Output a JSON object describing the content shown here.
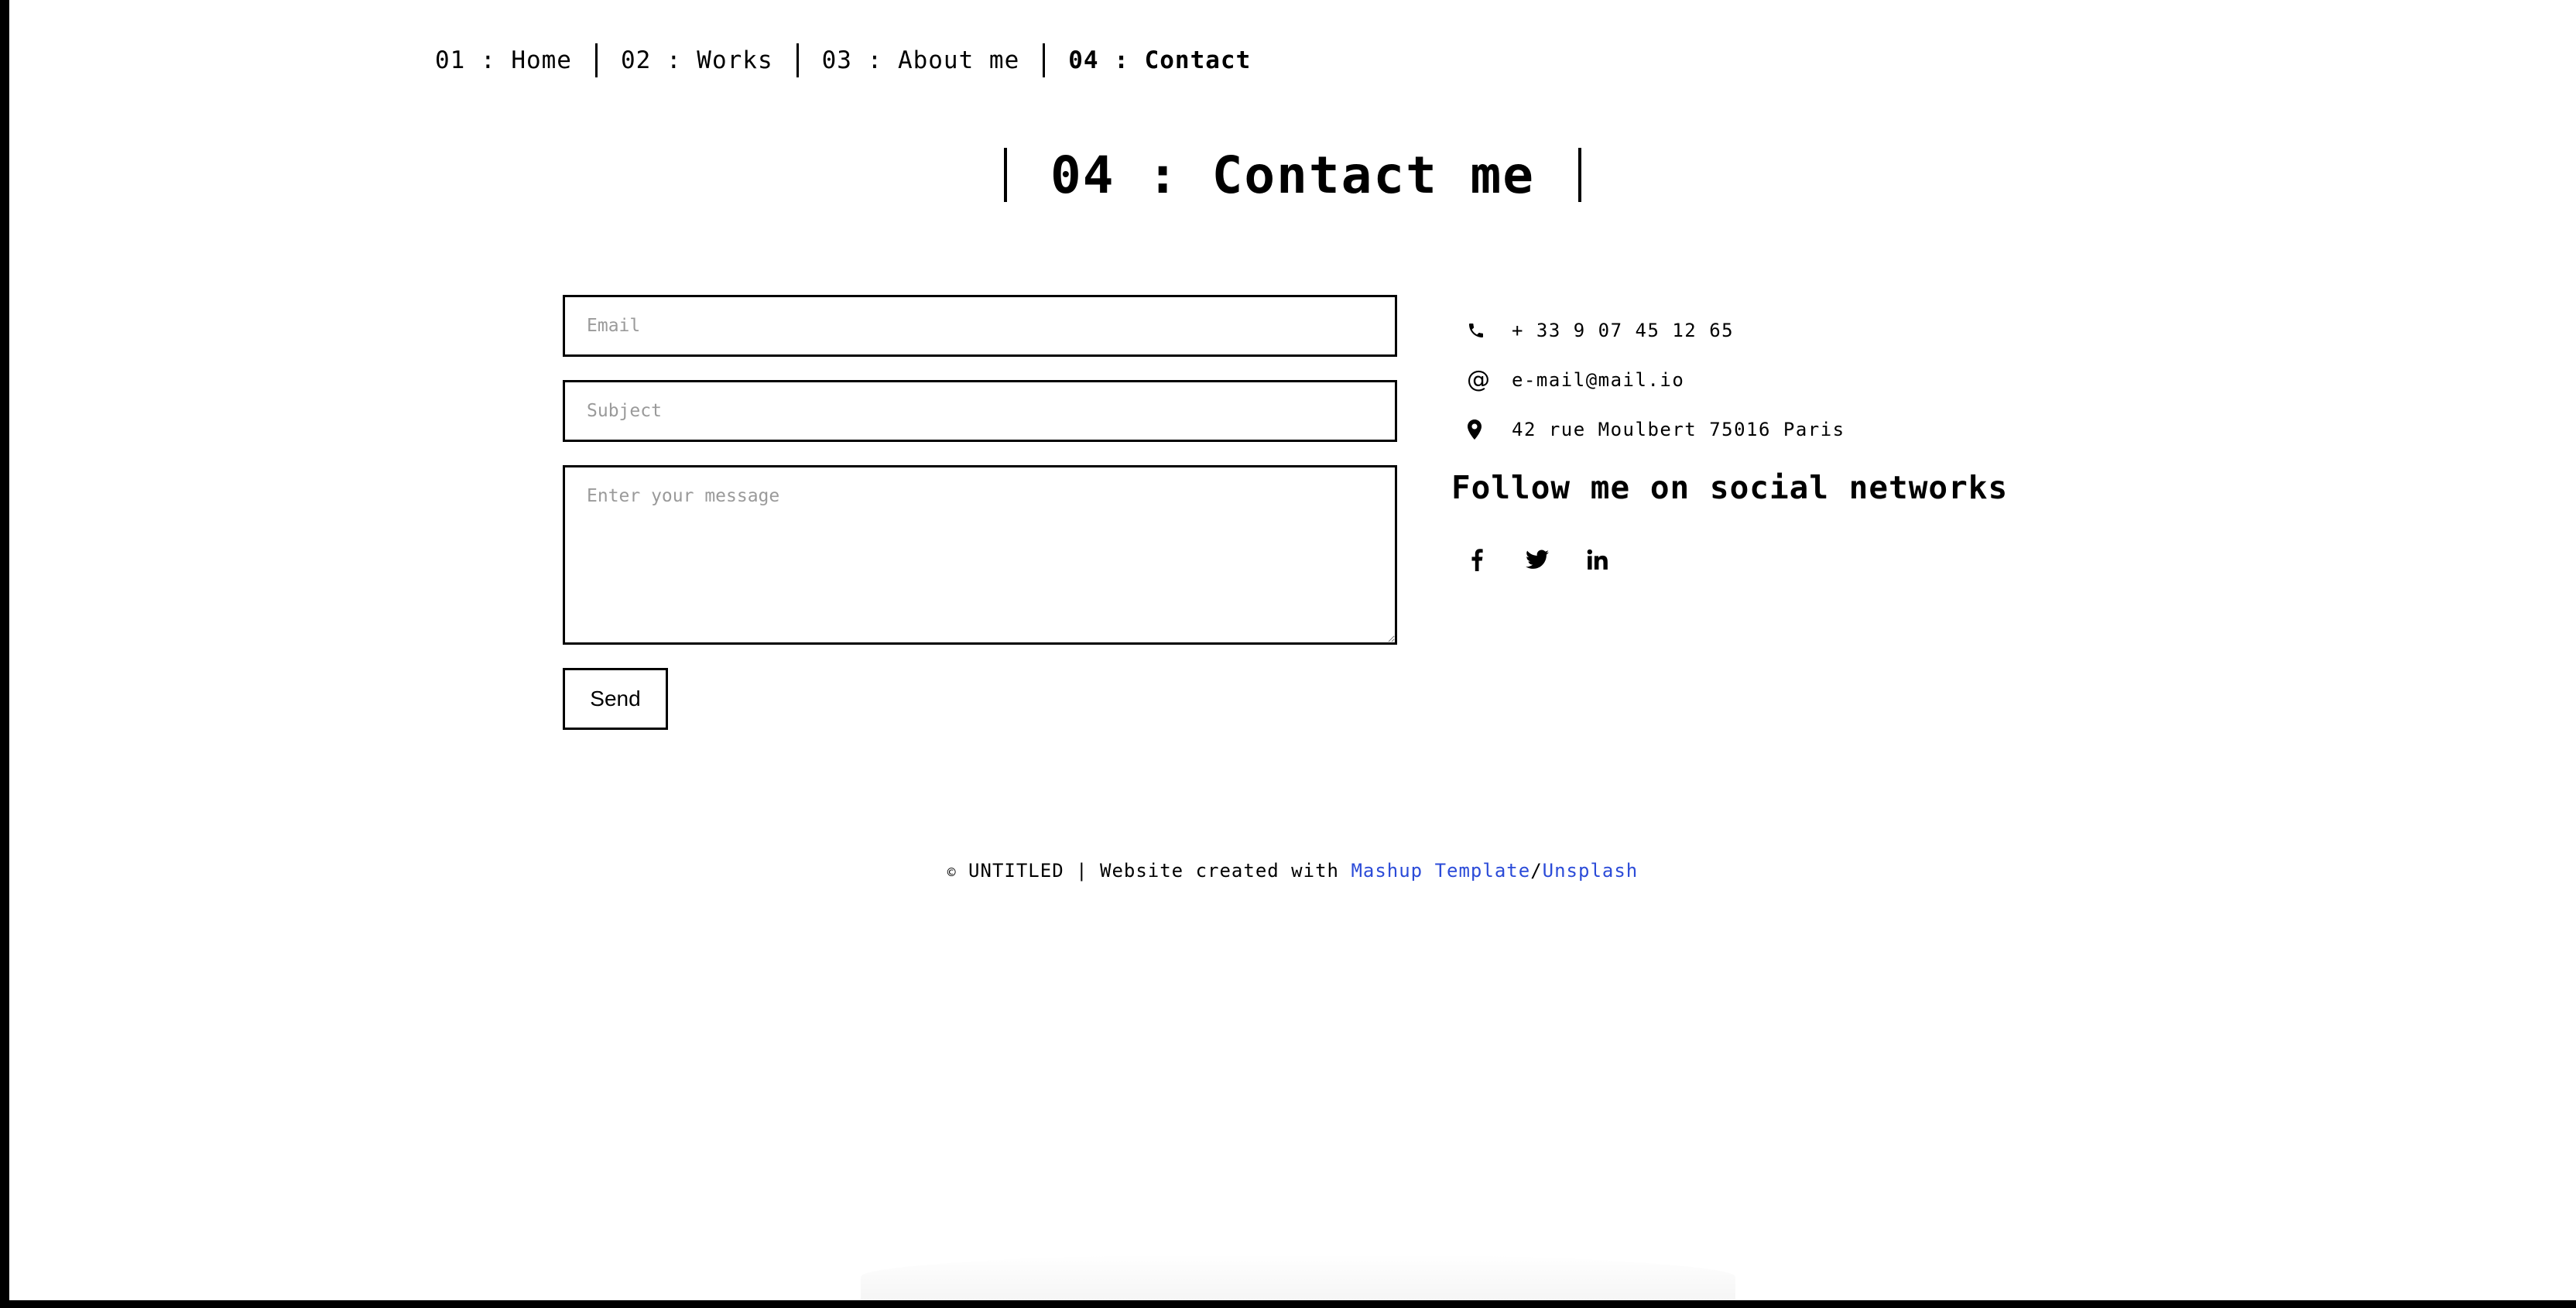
{
  "nav": {
    "items": [
      {
        "label": "01 : Home"
      },
      {
        "label": "02 : Works"
      },
      {
        "label": "03 : About me"
      },
      {
        "label": "04 : Contact"
      }
    ]
  },
  "page_title": "04 : Contact me",
  "form": {
    "email_placeholder": "Email",
    "subject_placeholder": "Subject",
    "message_placeholder": "Enter your message",
    "send_label": "Send"
  },
  "contact": {
    "phone": "+ 33 9 07 45 12 65",
    "email": "e-mail@mail.io",
    "address": "42 rue Moulbert 75016 Paris",
    "at_glyph": "@"
  },
  "social": {
    "heading": "Follow me on social networks",
    "icons": [
      "facebook-icon",
      "twitter-icon",
      "linkedin-icon"
    ]
  },
  "footer": {
    "copyright_symbol": "©",
    "prefix": "UNTITLED | Website created with",
    "link1": "Mashup Template",
    "separator": "/",
    "link2": "Unsplash"
  },
  "colors": {
    "link": "#2b4bd8",
    "text": "#000000",
    "background": "#ffffff",
    "placeholder": "#9a9a9a"
  }
}
